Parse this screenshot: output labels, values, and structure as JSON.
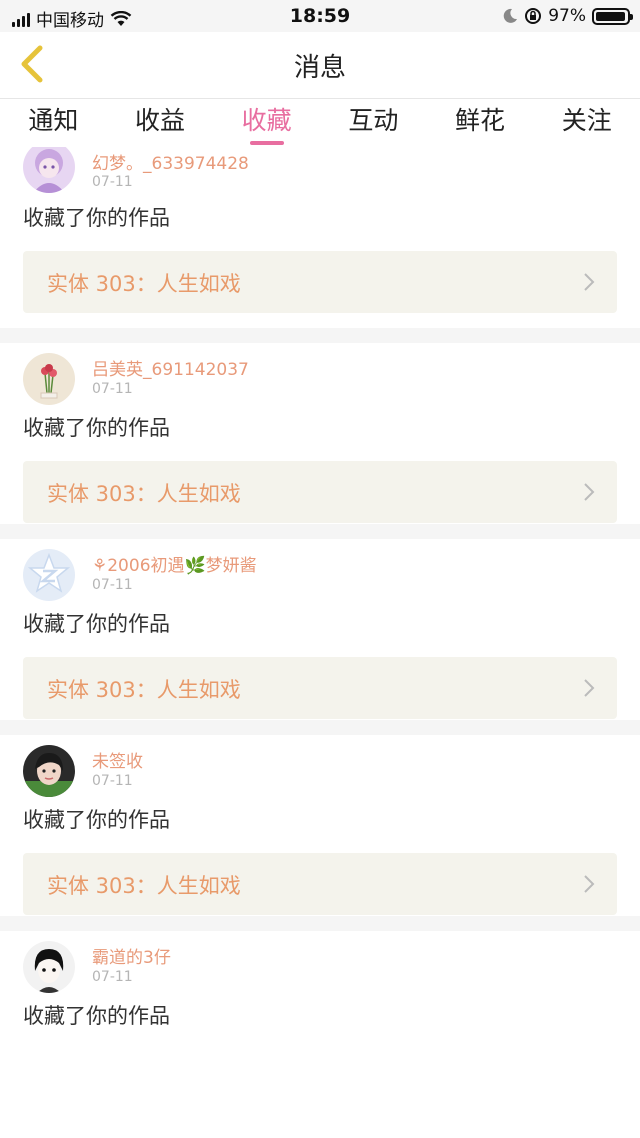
{
  "status_bar": {
    "carrier": "中国移动",
    "time": "18:59",
    "battery": "97%",
    "icons": [
      "signal-icon",
      "wifi-icon",
      "moon-icon",
      "rotation-lock-icon",
      "battery-icon"
    ]
  },
  "nav": {
    "title": "消息",
    "back_icon": "chevron-left-icon",
    "back_color": "#e6c33a"
  },
  "tabs": [
    {
      "label": "通知",
      "active": false
    },
    {
      "label": "收益",
      "active": false
    },
    {
      "label": "收藏",
      "active": true
    },
    {
      "label": "互动",
      "active": false
    },
    {
      "label": "鲜花",
      "active": false
    },
    {
      "label": "关注",
      "active": false
    }
  ],
  "accent_color": "#e86ea0",
  "items": [
    {
      "user": "幻梦。_633974428",
      "date": "07-11",
      "action": "收藏了你的作品",
      "work": "实体 303：人生如戏"
    },
    {
      "user": "吕美英_691142037",
      "date": "07-11",
      "action": "收藏了你的作品",
      "work": "实体 303：人生如戏"
    },
    {
      "user": "⚘2006初遇🌿梦妍酱",
      "date": "07-11",
      "action": "收藏了你的作品",
      "work": "实体 303：人生如戏"
    },
    {
      "user": "未签收",
      "date": "07-11",
      "action": "收藏了你的作品",
      "work": "实体 303：人生如戏"
    },
    {
      "user": "霸道的3仔",
      "date": "07-11",
      "action": "收藏了你的作品",
      "work": ""
    }
  ]
}
